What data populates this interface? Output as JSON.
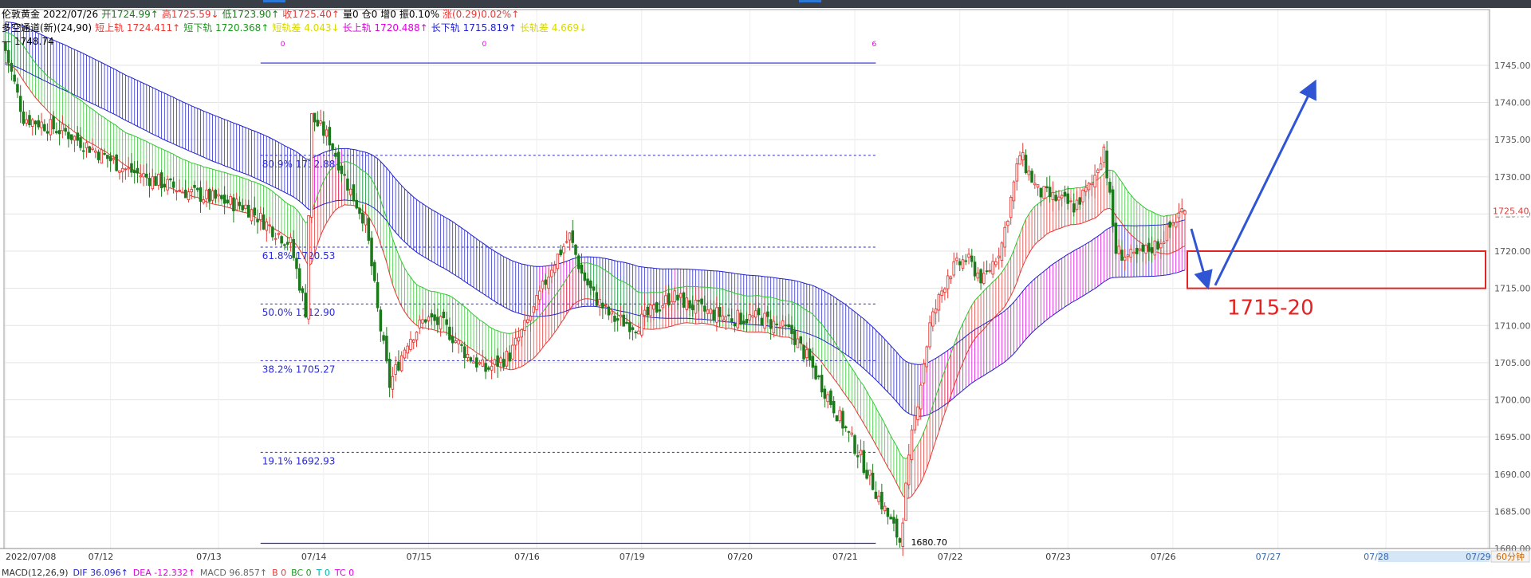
{
  "header": {
    "instrument": "伦敦黄金",
    "date": "2022/07/26",
    "open": "开1724.99↑",
    "high": "高1725.59↓",
    "low": "低1723.90↑",
    "close": "收1725.40↑",
    "volume": "量0",
    "position": "仓0",
    "increase": "增0",
    "amplitude": "振0.10%",
    "change": "涨(0.29)0.02%↑",
    "indicator_name": "多空通道(新)(24,90)",
    "short_upper": "短上轨 1724.411↑",
    "short_lower": "短下轨 1720.368↑",
    "short_diff": "短轨差 4.043↓",
    "long_upper": "长上轨 1720.488↑",
    "long_lower": "长下轨 1715.819↑",
    "long_diff": "长轨差 4.669↓",
    "top_value": "1748.74"
  },
  "macd": {
    "name": "MACD(12,26,9)",
    "dif": "DIF 36.096↑",
    "dea": "DEA -12.332↑",
    "macd": "MACD 96.857↑",
    "b": "B 0",
    "bc": "BC 0",
    "t": "T 0",
    "tc": "TC 0"
  },
  "colors": {
    "bull": "#e53935",
    "bear": "#1b7a1b",
    "short_channel": "#32c832",
    "long_channel": "#2222cc",
    "magenta": "#e000e0",
    "fib": "#2a2ad8",
    "annotation": "#e52222",
    "arrow": "#2f55d4"
  },
  "chart_data": {
    "type": "candlestick",
    "title": "伦敦黄金 2022/07/26",
    "timeframe": "60分钟",
    "ylim": [
      1680,
      1748.74
    ],
    "y_ticks": [
      1680,
      1685,
      1690,
      1695,
      1700,
      1705,
      1710,
      1715,
      1720,
      1725,
      1730,
      1735,
      1740,
      1745
    ],
    "y_tick_labels": [
      "1680.00",
      "1685.00",
      "1690.00",
      "1695.00",
      "1700.00",
      "1705.00",
      "1710.00",
      "1715.00",
      "1720.00",
      "1725.00",
      "1730.00",
      "1735.00",
      "1740.00",
      "1745.00"
    ],
    "x_labels": [
      "2022/07/08",
      "07/12",
      "07/13",
      "07/14",
      "07/15",
      "07/16",
      "07/19",
      "07/20",
      "07/21",
      "07/22",
      "07/23",
      "07/26",
      "07/27",
      "07/28",
      "07/29"
    ],
    "current_price": "1725.40",
    "low_marker": "1680.70",
    "fibonacci": [
      {
        "label": "80.9% 1732.88",
        "value": 1732.88
      },
      {
        "label": "61.8% 1720.53",
        "value": 1720.53
      },
      {
        "label": "50.0% 1712.90",
        "value": 1712.9
      },
      {
        "label": "38.2% 1705.27",
        "value": 1705.27
      },
      {
        "label": "19.1% 1692.93",
        "value": 1692.93
      }
    ],
    "fib_top": 1745.3,
    "fib_bottom": 1680.7,
    "fib_markers": [
      "0",
      "0",
      "6"
    ],
    "annotation": {
      "label": "1715-20",
      "low": 1715,
      "high": 1720
    },
    "grid": true,
    "close_path": [
      [
        0,
        1747
      ],
      [
        6,
        1738
      ],
      [
        20,
        1736
      ],
      [
        40,
        1731
      ],
      [
        60,
        1728
      ],
      [
        80,
        1726
      ],
      [
        95,
        1721
      ],
      [
        100,
        1712
      ],
      [
        102,
        1738
      ],
      [
        108,
        1735
      ],
      [
        115,
        1728
      ],
      [
        120,
        1724
      ],
      [
        124,
        1712
      ],
      [
        128,
        1702
      ],
      [
        134,
        1708
      ],
      [
        140,
        1711
      ],
      [
        146,
        1710
      ],
      [
        154,
        1706
      ],
      [
        160,
        1704
      ],
      [
        168,
        1706
      ],
      [
        176,
        1712
      ],
      [
        182,
        1718
      ],
      [
        188,
        1722
      ],
      [
        192,
        1717
      ],
      [
        196,
        1714
      ],
      [
        202,
        1711
      ],
      [
        210,
        1710
      ],
      [
        222,
        1714
      ],
      [
        232,
        1712
      ],
      [
        242,
        1711
      ],
      [
        252,
        1711
      ],
      [
        262,
        1709
      ],
      [
        268,
        1705
      ],
      [
        276,
        1699
      ],
      [
        284,
        1693
      ],
      [
        292,
        1686
      ],
      [
        298,
        1681
      ],
      [
        302,
        1695
      ],
      [
        308,
        1710
      ],
      [
        314,
        1717
      ],
      [
        320,
        1719
      ],
      [
        326,
        1716
      ],
      [
        332,
        1721
      ],
      [
        338,
        1733
      ],
      [
        344,
        1728
      ],
      [
        350,
        1727
      ],
      [
        356,
        1726
      ],
      [
        362,
        1729
      ],
      [
        366,
        1734
      ],
      [
        370,
        1720
      ],
      [
        376,
        1719
      ],
      [
        384,
        1721
      ],
      [
        392,
        1725.4
      ]
    ],
    "bars_total": 495,
    "visible_bars": 393
  }
}
